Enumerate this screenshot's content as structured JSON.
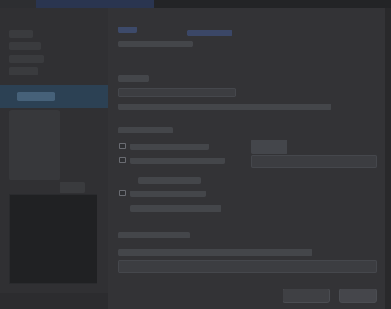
{
  "window": {
    "title": ""
  },
  "sidebar": {
    "items": [
      {
        "label": ""
      },
      {
        "label": ""
      },
      {
        "label": ""
      },
      {
        "label": ""
      },
      {
        "label": ""
      }
    ],
    "active_label": ""
  },
  "main": {
    "heading": "",
    "subheading": "",
    "section1_title": "",
    "section1_text": "",
    "section2_title": "",
    "option1": "",
    "option2": "",
    "option3": "",
    "section3_title": "",
    "section3_text": "",
    "footer_hint": ""
  },
  "buttons": {
    "cancel": "",
    "ok": ""
  },
  "colors": {
    "background": "#2b2b2d",
    "sidebar": "#303033",
    "selection": "#2c4154",
    "accent_link": "#8f9dd6"
  }
}
